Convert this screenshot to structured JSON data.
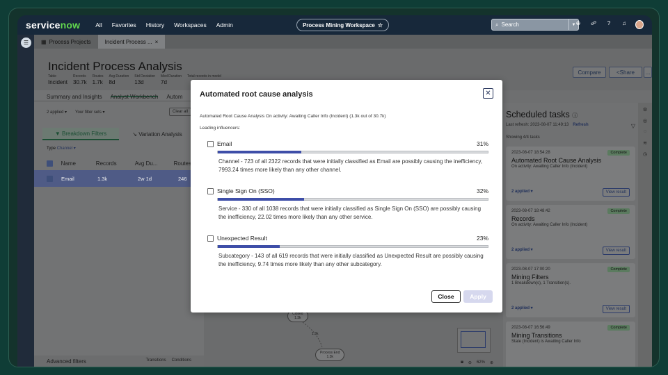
{
  "nav": {
    "logo_a": "service",
    "logo_b": "now",
    "links": [
      "All",
      "Favorites",
      "History",
      "Workspaces",
      "Admin"
    ],
    "workspace_label": "Process Mining Workspace",
    "search_placeholder": "Search"
  },
  "tabs": [
    {
      "label": "Process Projects"
    },
    {
      "label": "Incident Process ...",
      "close": "×"
    }
  ],
  "page": {
    "title": "Incident Process Analysis",
    "metrics": [
      {
        "label": "Table",
        "value": "Incident"
      },
      {
        "label": "Records",
        "value": "30.7k"
      },
      {
        "label": "Routes",
        "value": "1.7k"
      },
      {
        "label": "Avg Duration",
        "value": "8d"
      },
      {
        "label": "Std Deviation",
        "value": "13d"
      },
      {
        "label": "Med Duration",
        "value": "7d"
      },
      {
        "label": "Total records in model",
        "value": ""
      }
    ],
    "compare_label": "Compare",
    "share_label": "Share",
    "more_label": "..."
  },
  "left": {
    "subtabs": [
      "Summary and Insights",
      "Analyst Workbench",
      "Autom"
    ],
    "applied": "2 applied ▾",
    "filter_sets": "Your filter sets ▾",
    "clear_all": "Clear all",
    "breakdown": "Breakdown Filters",
    "variation": "Variation Analysis",
    "type_label": "Type",
    "type_value": "Channel ▾",
    "columns": [
      "Name",
      "Records",
      "Avg Du...",
      "Routes"
    ],
    "row": {
      "name": "Email",
      "records": "1.3k",
      "avg": "2w 1d",
      "routes": "246"
    },
    "advanced": "Advanced filters",
    "transitions": "Transitions",
    "conditions": "Conditions"
  },
  "canvas": {
    "node1": "Closed",
    "node1_sub": "1.3k",
    "edge_label": "1.3k",
    "node2": "Process End",
    "node2_sub": "1.3k",
    "zoom": "62%"
  },
  "right": {
    "title": "Scheduled tasks",
    "last_refresh": "Last refresh: 2023-08-07 11:49:13",
    "refresh": "Refresh",
    "showing": "Showing 4/4 tasks",
    "cards": [
      {
        "date": "2023-08-07 18:54:28",
        "status": "Complete",
        "name": "Automated Root Cause Analysis",
        "desc": "On activity: Awaiting Caller Info (Incident)",
        "applied": "2 applied ▾",
        "view": "View result"
      },
      {
        "date": "2023-08-07 18:48:42",
        "status": "Complete",
        "name": "Records",
        "desc": "On activity: Awaiting Caller Info (Incident)",
        "applied": "2 applied ▾",
        "view": "View result"
      },
      {
        "date": "2023-08-07 17:00:20",
        "status": "Complete",
        "name": "Mining Filters",
        "desc": "1 Breakdown(s), 1 Transition(s).",
        "applied": "2 applied ▾",
        "view": "View result"
      },
      {
        "date": "2023-08-07 16:56:49",
        "status": "Complete",
        "name": "Mining Transitions",
        "desc": "State (Incident) is Awaiting Caller Info",
        "applied": "",
        "view": ""
      }
    ]
  },
  "modal": {
    "title": "Automated root cause analysis",
    "subtitle": "Automated Root Cause Analysis On activity: Awaiting Caller Info (Incident) (1.3k out of 30.7k)",
    "leading": "Leading influencers:",
    "items": [
      {
        "label": "Email",
        "pct": "31%",
        "fraction": 0.31,
        "desc": "Channel - 723 of all 2322 records that were initially classified as Email are possibly causing the inefficiency, 7993.24 times more likely than any other channel."
      },
      {
        "label": "Single Sign On (SSO)",
        "pct": "32%",
        "fraction": 0.32,
        "desc": "Service - 330 of all 1038 records that were initially classified as Single Sign On (SSO) are possibly causing the inefficiency, 22.02 times more likely than any other service."
      },
      {
        "label": "Unexpected Result",
        "pct": "23%",
        "fraction": 0.23,
        "desc": "Subcategory - 143 of all 619 records that were initially classified as Unexpected Result are possibly causing the inefficiency, 9.74 times more likely than any other subcategory."
      }
    ],
    "close_label": "Close",
    "apply_label": "Apply"
  },
  "colors": {
    "accent": "#3e4ea8",
    "nav_bg": "#17283a",
    "logo_green": "#62d84e"
  }
}
